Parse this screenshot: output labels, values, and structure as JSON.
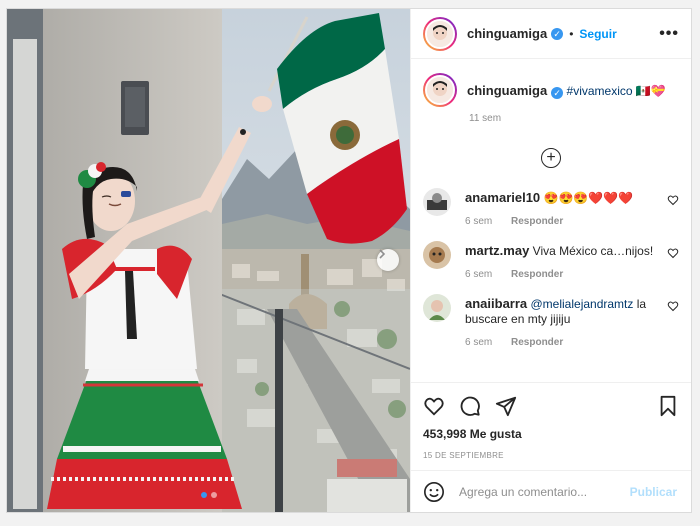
{
  "post": {
    "username": "chinguamiga",
    "verified": "✓",
    "separator": "•",
    "follow_label": "Seguir",
    "more_label": "•••"
  },
  "caption": {
    "username": "chinguamiga",
    "hashtag": "#vivamexico",
    "emoji": "🇲🇽💝",
    "time": "11 sem"
  },
  "comments": [
    {
      "username": "anamariel10",
      "text": "😍😍😍❤️❤️❤️",
      "time": "6 sem",
      "reply": "Responder"
    },
    {
      "username": "martz.may",
      "text": "Viva México ca…nijos!",
      "time": "6 sem",
      "reply": "Responder"
    },
    {
      "username": "anaiibarra",
      "mention": "@melialejandramtz",
      "text": " la buscare en mty jijiju",
      "time": "6 sem",
      "reply": "Responder"
    }
  ],
  "stats": {
    "likes": "453,998 Me gusta",
    "date": "15 DE SEPTIEMBRE"
  },
  "add_comment": {
    "placeholder": "Agrega un comentario...",
    "publish": "Publicar"
  },
  "icons": {
    "like": "heart-icon",
    "comment": "comment-icon",
    "share": "send-icon",
    "save": "bookmark-icon",
    "more": "more-options-icon",
    "emoji": "emoji-icon",
    "load_more": "plus-circle-icon",
    "next": "chevron-right-icon"
  },
  "colors": {
    "accent": "#0095f6",
    "verified": "#3897f0",
    "flag_green": "#006847",
    "flag_red": "#ce1126"
  }
}
